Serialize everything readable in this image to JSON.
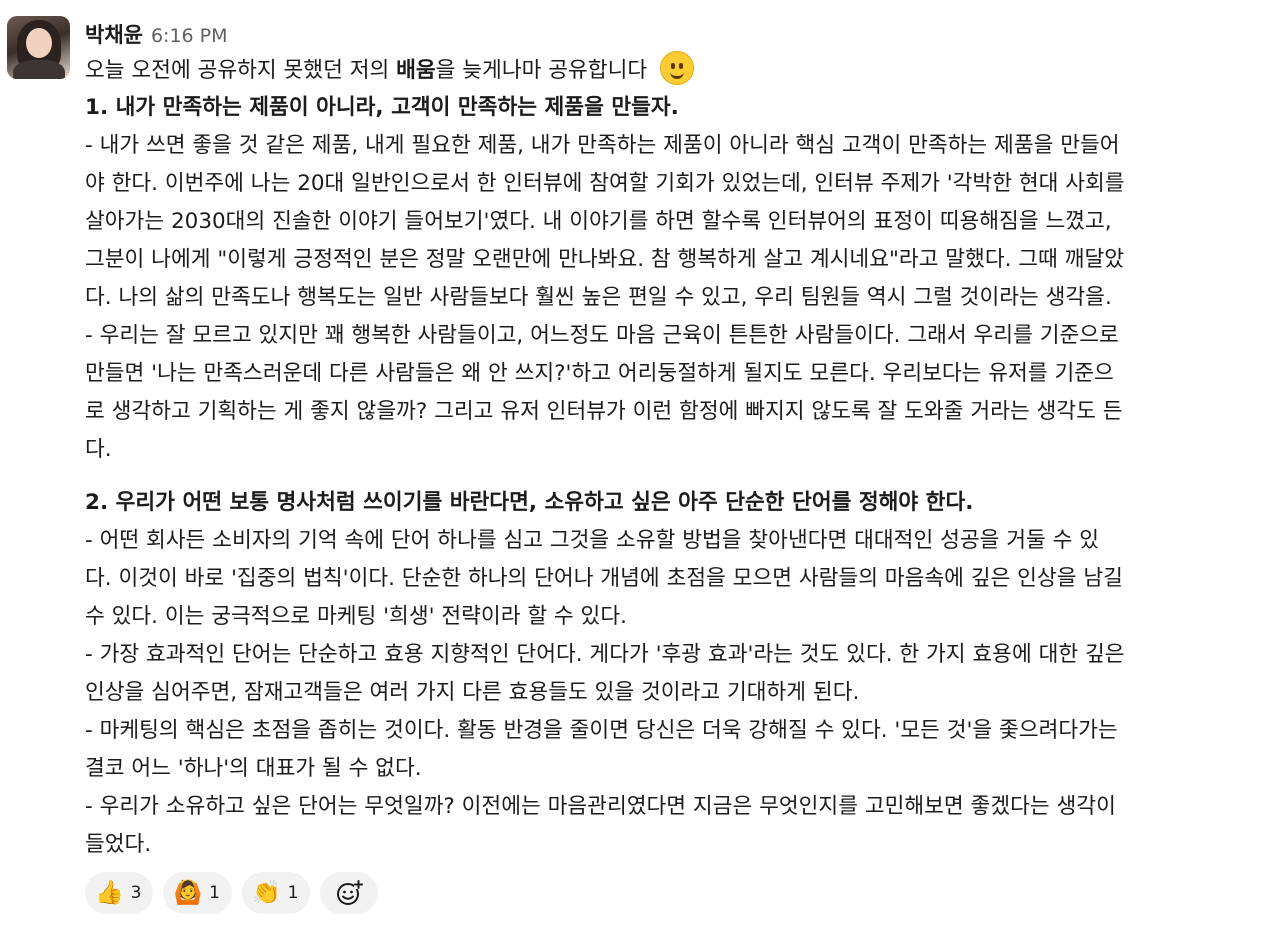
{
  "message": {
    "author": "박채윤",
    "time": "6:16 PM",
    "intro_pre": "오늘 오전에 공유하지 못했던 저의 ",
    "intro_bold": "배움",
    "intro_post": "을 늦게나마 공유합니다",
    "intro_emoji": "slightly-smiling-face",
    "lines": [
      "1. 내가 만족하는 제품이 아니라, 고객이 만족하는 제품을 만들자.",
      "- 내가 쓰면 좋을 것 같은 제품, 내게 필요한 제품, 내가 만족하는 제품이 아니라 핵심 고객이 만족하는 제품을 만들어",
      "야 한다. 이번주에 나는 20대 일반인으로서 한 인터뷰에 참여할 기회가 있었는데, 인터뷰 주제가 '각박한 현대 사회를",
      "살아가는 2030대의 진솔한 이야기 들어보기'였다. 내 이야기를 하면 할수록 인터뷰어의 표정이 띠용해짐을 느꼈고,",
      "그분이 나에게 \"이렇게 긍정적인 분은 정말 오랜만에 만나봐요. 참 행복하게 살고 계시네요\"라고 말했다. 그때 깨달았",
      "다. 나의 삶의 만족도나 행복도는 일반 사람들보다 훨씬 높은 편일 수 있고, 우리 팀원들 역시 그럴 것이라는 생각을.",
      "- 우리는 잘 모르고 있지만 꽤 행복한 사람들이고, 어느정도 마음 근육이 튼튼한 사람들이다. 그래서 우리를 기준으로",
      "만들면 '나는 만족스러운데 다른 사람들은 왜 안 쓰지?'하고 어리둥절하게 될지도 모른다. 우리보다는 유저를 기준으",
      "로 생각하고 기획하는 게 좋지 않을까? 그리고 유저 인터뷰가 이런 함정에 빠지지 않도록 잘 도와줄 거라는 생각도 든",
      "다.",
      "2. 우리가 어떤 보통 명사처럼 쓰이기를 바란다면, 소유하고 싶은 아주 단순한 단어를 정해야 한다.",
      "- 어떤 회사든 소비자의 기억 속에 단어 하나를 심고 그것을 소유할 방법을 찾아낸다면 대대적인 성공을 거둘 수 있",
      "다. 이것이 바로 '집중의 법칙'이다. 단순한 하나의 단어나 개념에 초점을 모으면 사람들의 마음속에 깊은 인상을 남길",
      "수 있다. 이는 궁극적으로 마케팅 '희생' 전략이라 할 수 있다.",
      "- 가장 효과적인 단어는 단순하고 효용 지향적인 단어다. 게다가 '후광 효과'라는 것도 있다. 한 가지 효용에 대한 깊은",
      "인상을 심어주면, 잠재고객들은 여러 가지 다른 효용들도 있을 것이라고 기대하게 된다.",
      "- 마케팅의 핵심은 초점을 좁히는 것이다. 활동 반경을 줄이면 당신은 더욱 강해질 수 있다. '모든 것'을 좇으려다가는",
      "결코 어느 '하나'의 대표가 될 수 없다.",
      "- 우리가 소유하고 싶은 단어는 무엇일까? 이전에는 마음관리였다면 지금은 무엇인지를 고민해보면 좋겠다는 생각이",
      "들었다."
    ]
  },
  "reactions": [
    {
      "icon": "thumbs-up",
      "glyph": "👍",
      "count": "3"
    },
    {
      "icon": "person-bowing",
      "glyph": "🙆",
      "count": "1"
    },
    {
      "icon": "clapping-hands",
      "glyph": "👏",
      "count": "1"
    }
  ],
  "add_reaction_icon": "add-reaction-icon"
}
